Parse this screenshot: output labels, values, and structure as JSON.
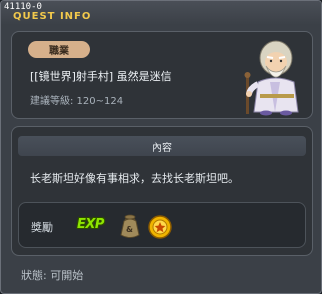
{
  "window": {
    "quest_id": "41110-0",
    "title": "QUEST INFO"
  },
  "quest": {
    "job_badge": "職業",
    "title": "[[镜世界]射手村] 虽然是迷信",
    "level": "建議等級: 120~124"
  },
  "content": {
    "header": "內容",
    "text": "长老斯坦好像有事相求，去找长老斯坦吧。",
    "reward_label": "獎勵",
    "reward_exp": "EXP",
    "reward_icons": [
      "exp-icon",
      "meso-bag-icon",
      "medal-icon"
    ]
  },
  "status": {
    "text": "狀態:  可開始"
  },
  "colors": {
    "title_accent": "#f2c94c",
    "badge_bg": "#d6b08b",
    "exp_green": "#8ee600",
    "panel_bg": "#2f3338",
    "window_bg": "#3b4047"
  }
}
